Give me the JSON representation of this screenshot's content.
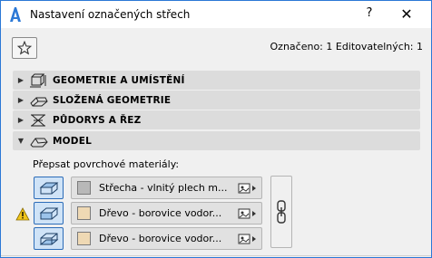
{
  "window": {
    "title": "Nastavení označených střech",
    "help_glyph": "?",
    "close_glyph": "✕"
  },
  "selection_info": "Označeno: 1 Editovatelných: 1",
  "panels": [
    {
      "label": "GEOMETRIE A UMÍSTĚNÍ",
      "icon": "geometry-placement-icon",
      "expanded": false
    },
    {
      "label": "SLOŽENÁ GEOMETRIE",
      "icon": "complex-geometry-icon",
      "expanded": false
    },
    {
      "label": "PŮDORYS A ŘEZ",
      "icon": "floor-plan-section-icon",
      "expanded": false
    },
    {
      "label": "MODEL",
      "icon": "model-icon",
      "expanded": true
    }
  ],
  "model": {
    "override_label": "Přepsat povrchové materiály:",
    "materials": [
      {
        "name": "Střecha - vlnitý plech m...",
        "swatch_color": "#b8b8b8",
        "surface": "top"
      },
      {
        "name": "Dřevo - borovice vodor...",
        "swatch_color": "#efd9b4",
        "surface": "edge"
      },
      {
        "name": "Dřevo - borovice vodor...",
        "swatch_color": "#efd9b4",
        "surface": "bottom"
      }
    ]
  },
  "colors": {
    "accent": "#2b78d6",
    "panel_bg": "#dcdcdc",
    "button_active_bg": "#cfe3f7",
    "button_active_border": "#2c6cb8",
    "warning": "#f0c419"
  }
}
